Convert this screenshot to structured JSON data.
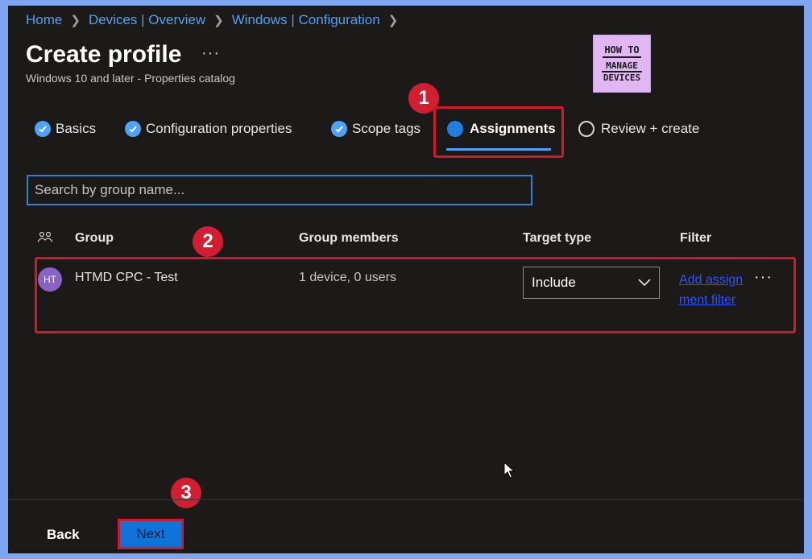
{
  "breadcrumb": [
    "Home",
    "Devices | Overview",
    "Windows | Configuration"
  ],
  "page": {
    "title": "Create profile",
    "more": "···",
    "subtitle": "Windows 10 and later - Properties catalog"
  },
  "logo": {
    "line1": "HOW TO",
    "line2": "MANAGE",
    "line3": "DEVICES"
  },
  "tabs": [
    {
      "label": "Basics",
      "state": "completed"
    },
    {
      "label": "Configuration properties",
      "state": "completed"
    },
    {
      "label": "Scope tags",
      "state": "completed"
    },
    {
      "label": "Assignments",
      "state": "active"
    },
    {
      "label": "Review + create",
      "state": "pending"
    }
  ],
  "search": {
    "placeholder": "Search by group name..."
  },
  "table": {
    "headers": {
      "group": "Group",
      "members": "Group members",
      "target": "Target type",
      "filter": "Filter"
    },
    "rows": [
      {
        "avatar": "HT",
        "group": "HTMD CPC - Test",
        "members": "1 device, 0 users",
        "target_type": "Include",
        "filter_link": "Add assignment filter",
        "more": "···"
      }
    ]
  },
  "annotations": [
    "1",
    "2",
    "3"
  ],
  "footer": {
    "back": "Back",
    "next": "Next"
  },
  "colors": {
    "accent": "#4ea1f3",
    "primary_button": "#0f74d8",
    "annotation": "#d41a2a",
    "background": "#1b1a19",
    "outer_frame": "#7ea6f0"
  },
  "icons": [
    "chevron-right-icon",
    "checkmark-icon",
    "people-icon",
    "chevron-down-icon",
    "more-icon",
    "cursor-icon"
  ]
}
